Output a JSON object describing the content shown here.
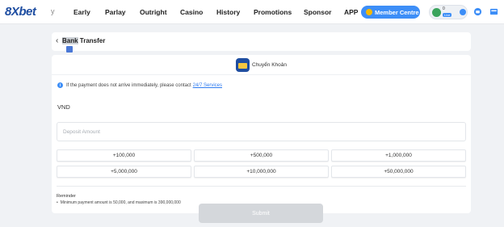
{
  "nav": {
    "logo": "8Xbet",
    "scroll_hint": "y",
    "items": [
      "Early",
      "Parlay",
      "Outright",
      "Casino",
      "History",
      "Promotions",
      "Sponsor",
      "APP"
    ],
    "member_label": "Member Centre",
    "balance_value": "0",
    "balance_tag": "Live"
  },
  "page": {
    "title_highlight": "Bank",
    "title_rest": " Transfer",
    "back_symbol": "‹"
  },
  "method": {
    "label": "Chuyển Khoản"
  },
  "notice": {
    "text": "If the payment does not arrive immediately, please contact",
    "link": "24/7 Services"
  },
  "currency": "VND",
  "amount_input": {
    "placeholder": "Deposit Amount",
    "value": ""
  },
  "quick_amounts": [
    "+100,000",
    "+500,000",
    "+1,000,000",
    "+5,000,000",
    "+10,000,000",
    "+50,000,000"
  ],
  "reminder": {
    "title": "Reminder",
    "items": [
      "Minimum payment amount is 50,000, and maximum is 390,000,000"
    ]
  },
  "submit_label": "Submit",
  "colors": {
    "brand": "#1e4da1",
    "accent": "#3d8ef7",
    "link": "#2f7cf0",
    "disabled": "#d4d7db"
  }
}
